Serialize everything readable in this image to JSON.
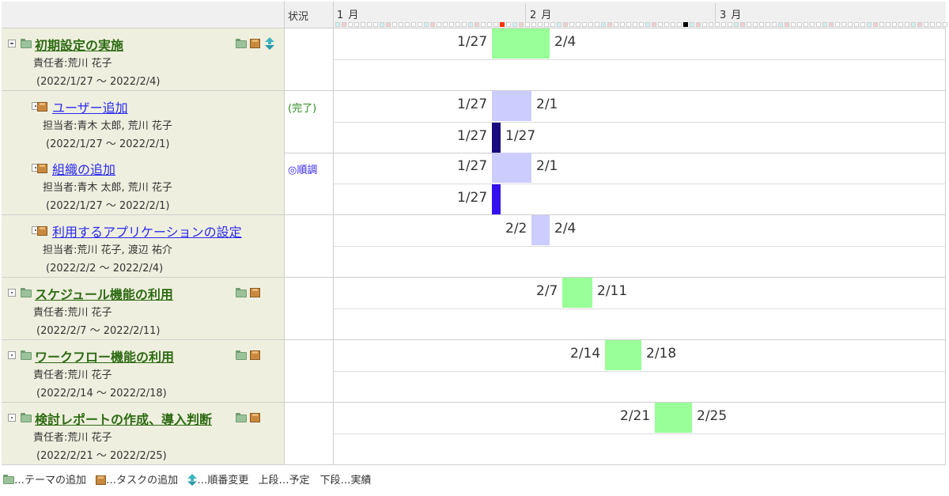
{
  "header": {
    "status_label": "状況",
    "months": [
      "1 月",
      "2 月",
      "3 月"
    ]
  },
  "rows": [
    {
      "kind": "theme",
      "title": "初期設定の実施",
      "person": "責任者:荒川 花子",
      "period": "(2022/1/27 ～ 2022/2/4)",
      "status": "",
      "plan": {
        "start_label": "1/27",
        "end_label": "2/4",
        "color": "#99ff99"
      },
      "actual": null
    },
    {
      "kind": "task",
      "title": "ユーザー追加",
      "person": "担当者:青木 太郎, 荒川 花子",
      "period": "(2022/1/27 ～ 2022/2/1)",
      "status": "(完了)",
      "status_color": "#2e8b22",
      "plan": {
        "start_label": "1/27",
        "end_label": "2/1",
        "color": "#ccccff"
      },
      "actual": {
        "start_label": "1/27",
        "end_label": "1/27",
        "color": "#1a0a80"
      }
    },
    {
      "kind": "task",
      "title": "組織の追加",
      "person": "担当者:青木 太郎, 荒川 花子",
      "period": "(2022/1/27 ～ 2022/2/1)",
      "status": "◎順調",
      "status_color": "#3322ee",
      "plan": {
        "start_label": "1/27",
        "end_label": "2/1",
        "color": "#ccccff"
      },
      "actual": {
        "start_label": "1/27",
        "end_label": "",
        "color": "#3311ee"
      }
    },
    {
      "kind": "task",
      "title": "利用するアプリケーションの設定",
      "person": "担当者:荒川 花子, 渡辺 祐介",
      "period": "(2022/2/2 ～ 2022/2/4)",
      "status": "",
      "plan": {
        "start_label": "2/2",
        "end_label": "2/4",
        "color": "#ccccff"
      },
      "actual": null
    },
    {
      "kind": "theme",
      "title": "スケジュール機能の利用",
      "person": "責任者:荒川 花子",
      "period": "(2022/2/7 ～ 2022/2/11)",
      "status": "",
      "plan": {
        "start_label": "2/7",
        "end_label": "2/11",
        "color": "#99ff99"
      },
      "actual": null
    },
    {
      "kind": "theme",
      "title": "ワークフロー機能の利用",
      "person": "責任者:荒川 花子",
      "period": "(2022/2/14 ～ 2022/2/18)",
      "status": "",
      "plan": {
        "start_label": "2/14",
        "end_label": "2/18",
        "color": "#99ff99"
      },
      "actual": null
    },
    {
      "kind": "theme",
      "title": "検討レポートの作成、導入判断",
      "person": "責任者:荒川 花子",
      "period": "(2022/2/21 ～ 2022/2/25)",
      "status": "",
      "plan": {
        "start_label": "2/21",
        "end_label": "2/25",
        "color": "#99ff99"
      },
      "actual": null
    }
  ],
  "legend": {
    "add_theme": "…テーマの追加",
    "add_task": "…タスクの追加",
    "reorder": "…順番変更",
    "rows_note": "上段…予定　下段…実績"
  }
}
